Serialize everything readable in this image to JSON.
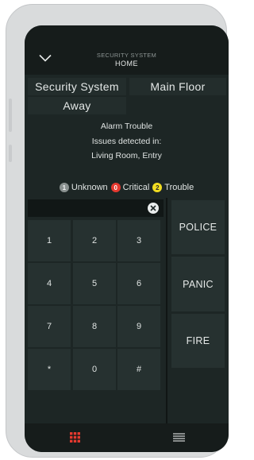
{
  "header": {
    "title": "SECURITY SYSTEM",
    "subtitle": "HOME"
  },
  "tiles": {
    "system": "Security System",
    "floor": "Main Floor",
    "mode": "Away"
  },
  "status": {
    "line1": "Alarm Trouble",
    "line2": "Issues detected in:",
    "line3": "Living Room, Entry"
  },
  "legend": [
    {
      "count": "1",
      "label": "Unknown",
      "color": "#8a9190"
    },
    {
      "count": "0",
      "label": "Critical",
      "color": "#e5392f"
    },
    {
      "count": "2",
      "label": "Trouble",
      "color": "#f2dd21"
    }
  ],
  "keypad": {
    "input_value": "",
    "keys": [
      "1",
      "2",
      "3",
      "4",
      "5",
      "6",
      "7",
      "8",
      "9",
      "*",
      "0",
      "#"
    ]
  },
  "emergency": {
    "police": "POLICE",
    "panic": "PANIC",
    "fire": "FIRE"
  },
  "colors": {
    "accent": "#e5392f",
    "screen_bg": "#1d2625",
    "tile_bg": "#263130"
  },
  "nav": {
    "keypad_icon": "keypad-grid-icon",
    "menu_icon": "list-menu-icon"
  }
}
